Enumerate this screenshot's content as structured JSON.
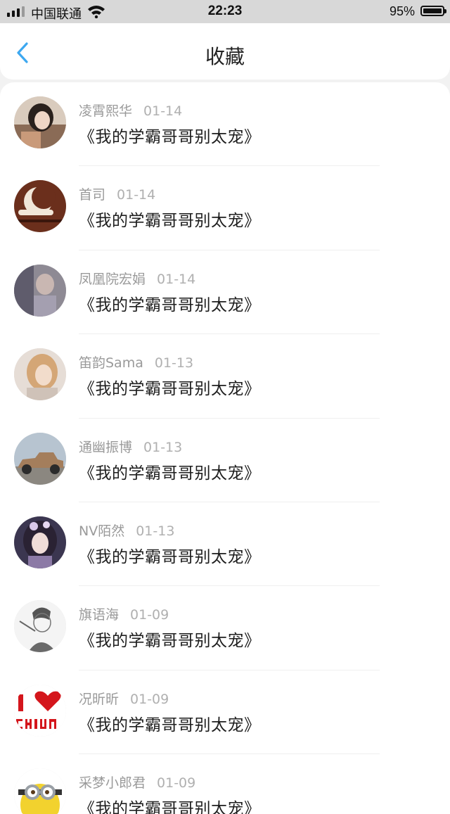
{
  "status_bar": {
    "carrier": "中国联通",
    "time": "22:23",
    "battery": "95%"
  },
  "header": {
    "title": "收藏"
  },
  "colors": {
    "accent": "#3da8f0",
    "header_bg": "#ffffff",
    "page_bg": "#f2f2f2"
  },
  "favorites": [
    {
      "user": "凌霄熙华",
      "date": "01-14",
      "book": "《我的学霸哥哥别太宠》",
      "avatar_icon": "girl-portrait-avatar"
    },
    {
      "user": "首司",
      "date": "01-14",
      "book": "《我的学霸哥哥别太宠》",
      "avatar_icon": "moon-emblem-avatar"
    },
    {
      "user": "凤凰院宏娟",
      "date": "01-14",
      "book": "《我的学霸哥哥别太宠》",
      "avatar_icon": "muted-portrait-avatar"
    },
    {
      "user": "笛韵Sama",
      "date": "01-13",
      "book": "《我的学霸哥哥别太宠》",
      "avatar_icon": "blonde-girl-avatar"
    },
    {
      "user": "通幽振博",
      "date": "01-13",
      "book": "《我的学霸哥哥别太宠》",
      "avatar_icon": "vintage-car-avatar"
    },
    {
      "user": "NV陌然",
      "date": "01-13",
      "book": "《我的学霸哥哥别太宠》",
      "avatar_icon": "anime-girl-avatar"
    },
    {
      "user": "旗语海",
      "date": "01-09",
      "book": "《我的学霸哥哥别太宠》",
      "avatar_icon": "sketch-boy-avatar"
    },
    {
      "user": "况昕昕",
      "date": "01-09",
      "book": "《我的学霸哥哥别太宠》",
      "avatar_icon": "i-love-china-avatar"
    },
    {
      "user": "采梦小郎君",
      "date": "01-09",
      "book": "《我的学霸哥哥别太宠》",
      "avatar_icon": "minion-avatar"
    }
  ]
}
